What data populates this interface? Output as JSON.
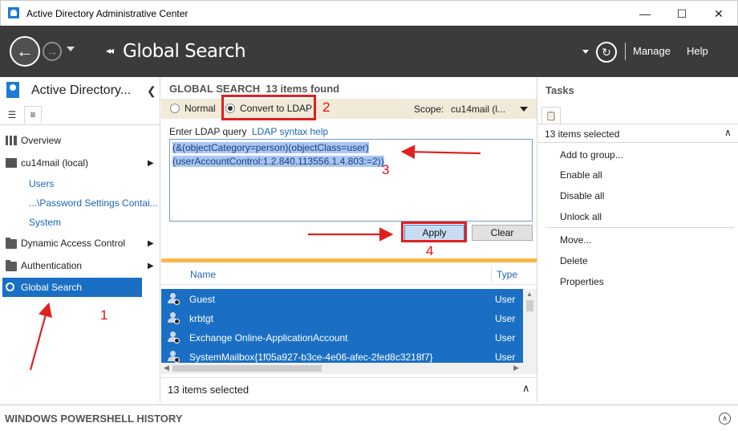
{
  "window": {
    "title": "Active Directory Administrative Center",
    "minimize": "—",
    "maximize": "☐",
    "close": "✕"
  },
  "header": {
    "breadcrumb_arrows": "◂◂",
    "breadcrumb_title": "Global Search",
    "manage": "Manage",
    "help": "Help"
  },
  "sidebar": {
    "title": "Active Directory...",
    "items": [
      {
        "label": "Overview"
      },
      {
        "label": "cu14mail (local)"
      },
      {
        "label": "Users"
      },
      {
        "label": "...\\Password Settings Contai..."
      },
      {
        "label": "System"
      },
      {
        "label": "Dynamic Access Control"
      },
      {
        "label": "Authentication"
      },
      {
        "label": "Global Search"
      }
    ]
  },
  "search": {
    "heading": "GLOBAL SEARCH",
    "found": "13 items found",
    "mode_normal": "Normal",
    "mode_ldap": "Convert to LDAP",
    "scope_label": "Scope:",
    "scope_value": "cu14mail (l...",
    "query_label": "Enter LDAP query",
    "syntax_help": "LDAP syntax help",
    "query_line1": "(&(objectCategory=person)(objectClass=user)",
    "query_line2": "(userAccountControl:1.2.840.113556.1.4.803:=2))",
    "apply": "Apply",
    "clear": "Clear"
  },
  "results": {
    "columns": [
      "Name",
      "Type"
    ],
    "rows": [
      {
        "name": "Guest",
        "type": "User"
      },
      {
        "name": "krbtgt",
        "type": "User"
      },
      {
        "name": "Exchange Online-ApplicationAccount",
        "type": "User"
      },
      {
        "name": "SystemMailbox{1f05a927-b3ce-4e06-afec-2fed8c3218f7}",
        "type": "User"
      }
    ],
    "footer": "13 items selected"
  },
  "tasks": {
    "title": "Tasks",
    "selection": "13 items selected",
    "group1": [
      "Add to group...",
      "Enable all",
      "Disable all",
      "Unlock all"
    ],
    "group2": [
      "Move...",
      "Delete",
      "Properties"
    ]
  },
  "powershell": {
    "title": "WINDOWS POWERSHELL HISTORY"
  },
  "annotations": {
    "step1": "1",
    "step2": "2",
    "step3": "3",
    "step4": "4",
    "color": "#e02020"
  }
}
